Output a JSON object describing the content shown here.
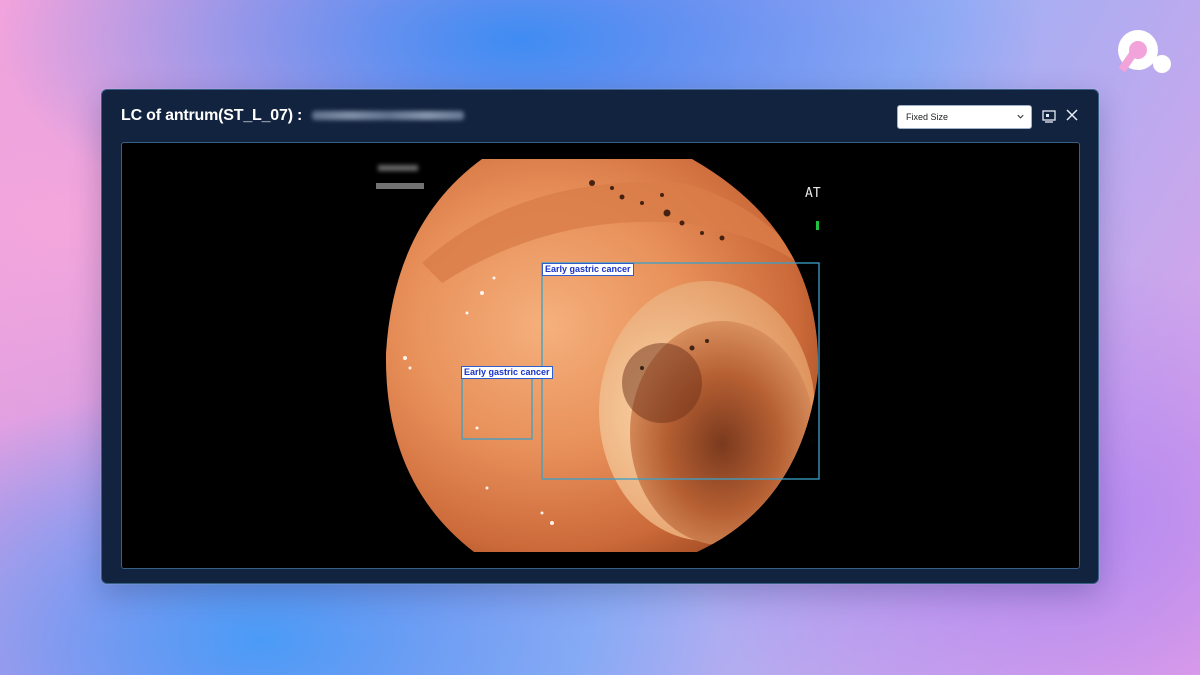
{
  "window": {
    "title": "LC of antrum(ST_L_07) :",
    "redacted_suffix_present": true
  },
  "toolbar": {
    "view_mode_selected": "Fixed Size"
  },
  "icons": {
    "brand_logo": "brand-logo-icon",
    "dropdown": "chevron-down-icon",
    "fit": "fit-window-icon",
    "close": "close-icon"
  },
  "image": {
    "overlay_text": "AT",
    "detections": [
      {
        "label": "Early gastric cancer"
      },
      {
        "label": "Early gastric cancer"
      }
    ]
  },
  "colors": {
    "window_bg": "#12233f",
    "viewer_bg": "#000000",
    "bbox": "#3aa0c8",
    "label_text": "#1833c8"
  }
}
